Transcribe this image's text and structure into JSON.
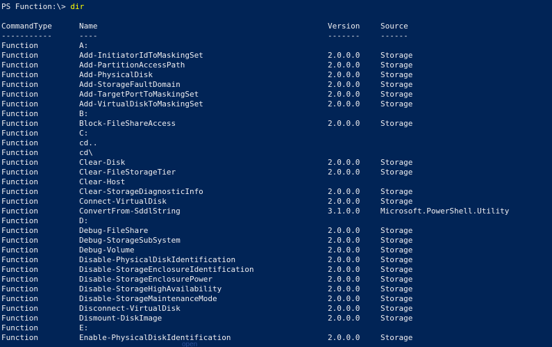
{
  "prompt": {
    "text": "PS Function:\\> ",
    "command": "dir"
  },
  "headers": {
    "type": "CommandType",
    "name": "Name",
    "version": "Version",
    "source": "Source"
  },
  "separators": {
    "type": "-----------",
    "name": "----",
    "version": "-------",
    "source": "------"
  },
  "rows": [
    {
      "type": "Function",
      "name": "A:",
      "version": "",
      "source": ""
    },
    {
      "type": "Function",
      "name": "Add-InitiatorIdToMaskingSet",
      "version": "2.0.0.0",
      "source": "Storage"
    },
    {
      "type": "Function",
      "name": "Add-PartitionAccessPath",
      "version": "2.0.0.0",
      "source": "Storage"
    },
    {
      "type": "Function",
      "name": "Add-PhysicalDisk",
      "version": "2.0.0.0",
      "source": "Storage"
    },
    {
      "type": "Function",
      "name": "Add-StorageFaultDomain",
      "version": "2.0.0.0",
      "source": "Storage"
    },
    {
      "type": "Function",
      "name": "Add-TargetPortToMaskingSet",
      "version": "2.0.0.0",
      "source": "Storage"
    },
    {
      "type": "Function",
      "name": "Add-VirtualDiskToMaskingSet",
      "version": "2.0.0.0",
      "source": "Storage"
    },
    {
      "type": "Function",
      "name": "B:",
      "version": "",
      "source": ""
    },
    {
      "type": "Function",
      "name": "Block-FileShareAccess",
      "version": "2.0.0.0",
      "source": "Storage"
    },
    {
      "type": "Function",
      "name": "C:",
      "version": "",
      "source": ""
    },
    {
      "type": "Function",
      "name": "cd..",
      "version": "",
      "source": ""
    },
    {
      "type": "Function",
      "name": "cd\\",
      "version": "",
      "source": ""
    },
    {
      "type": "Function",
      "name": "Clear-Disk",
      "version": "2.0.0.0",
      "source": "Storage"
    },
    {
      "type": "Function",
      "name": "Clear-FileStorageTier",
      "version": "2.0.0.0",
      "source": "Storage"
    },
    {
      "type": "Function",
      "name": "Clear-Host",
      "version": "",
      "source": ""
    },
    {
      "type": "Function",
      "name": "Clear-StorageDiagnosticInfo",
      "version": "2.0.0.0",
      "source": "Storage"
    },
    {
      "type": "Function",
      "name": "Connect-VirtualDisk",
      "version": "2.0.0.0",
      "source": "Storage"
    },
    {
      "type": "Function",
      "name": "ConvertFrom-SddlString",
      "version": "3.1.0.0",
      "source": "Microsoft.PowerShell.Utility"
    },
    {
      "type": "Function",
      "name": "D:",
      "version": "",
      "source": ""
    },
    {
      "type": "Function",
      "name": "Debug-FileShare",
      "version": "2.0.0.0",
      "source": "Storage"
    },
    {
      "type": "Function",
      "name": "Debug-StorageSubSystem",
      "version": "2.0.0.0",
      "source": "Storage"
    },
    {
      "type": "Function",
      "name": "Debug-Volume",
      "version": "2.0.0.0",
      "source": "Storage"
    },
    {
      "type": "Function",
      "name": "Disable-PhysicalDiskIdentification",
      "version": "2.0.0.0",
      "source": "Storage"
    },
    {
      "type": "Function",
      "name": "Disable-StorageEnclosureIdentification",
      "version": "2.0.0.0",
      "source": "Storage"
    },
    {
      "type": "Function",
      "name": "Disable-StorageEnclosurePower",
      "version": "2.0.0.0",
      "source": "Storage"
    },
    {
      "type": "Function",
      "name": "Disable-StorageHighAvailability",
      "version": "2.0.0.0",
      "source": "Storage"
    },
    {
      "type": "Function",
      "name": "Disable-StorageMaintenanceMode",
      "version": "2.0.0.0",
      "source": "Storage"
    },
    {
      "type": "Function",
      "name": "Disconnect-VirtualDisk",
      "version": "2.0.0.0",
      "source": "Storage"
    },
    {
      "type": "Function",
      "name": "Dismount-DiskImage",
      "version": "2.0.0.0",
      "source": "Storage"
    },
    {
      "type": "Function",
      "name": "E:",
      "version": "",
      "source": ""
    },
    {
      "type": "Function",
      "name": "Enable-PhysicalDiskIdentification",
      "version": "2.0.0.0",
      "source": "Storage"
    }
  ],
  "bottom_hint": "open",
  "colors": {
    "background": "#012456",
    "foreground": "#eeedf0",
    "command": "#ffff00"
  }
}
